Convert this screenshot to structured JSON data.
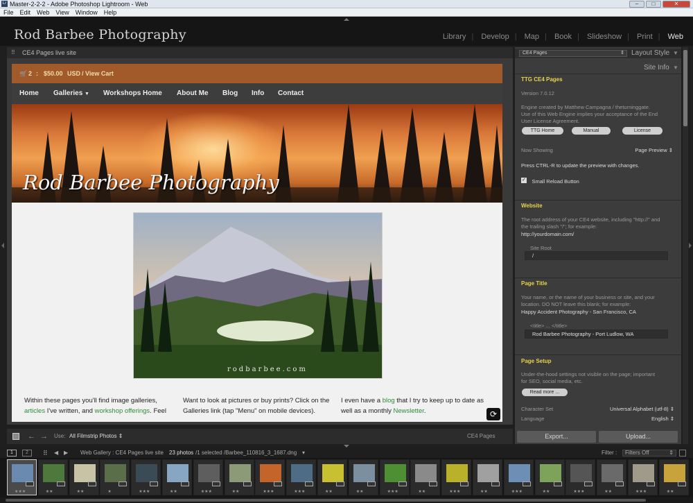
{
  "window": {
    "title": "Master-2-2-2 - Adobe Photoshop Lightroom - Web"
  },
  "menu": [
    "File",
    "Edit",
    "Web",
    "View",
    "Window",
    "Help"
  ],
  "identity_plate": "Rod Barbee Photography",
  "modules": [
    "Library",
    "Develop",
    "Map",
    "Book",
    "Slideshow",
    "Print",
    "Web"
  ],
  "active_module": "Web",
  "preview": {
    "header": "CE4 Pages live site",
    "cart": {
      "count": "2",
      "sep": ":",
      "amount": "$50.00",
      "currency": "USD",
      "view_cart": "/ View Cart"
    },
    "nav": [
      "Home",
      "Galleries",
      "Workshops Home",
      "About Me",
      "Blog",
      "Info",
      "Contact"
    ],
    "banner_title": "Rod Barbee Photography",
    "watermark": "rodbarbee.com",
    "col1": {
      "a": "Within these pages you'll find image galleries,",
      "link1": "articles",
      "b": " I've written, and ",
      "link2": "workshop offerings",
      "c": ". Feel"
    },
    "col2": {
      "a": "Want to look at pictures or buy prints? Click on the Galleries link (tap \"Menu\" on mobile devices)."
    },
    "col3": {
      "a": "I even have a ",
      "link1": "blog",
      "b": " that I try to keep up to date as well as a monthly ",
      "link2": "Newsletter",
      "c": "."
    }
  },
  "toolbar": {
    "use_label": "Use:",
    "use_value": "All Filmstrip Photos",
    "engine": "CE4 Pages"
  },
  "right_panel": {
    "layout_select": "CE4 Pages",
    "layout_style": "Layout Style",
    "site_info": "Site Info",
    "ttg": {
      "header": "TTG CE4 Pages",
      "version": "Version 7.0.12",
      "credit": "Engine created by Matthew Campagna / theturninggate. Use of this Web Engine implies your acceptance of the End User License Agreement.",
      "btn_home": "TTG Home",
      "btn_manual": "Manual",
      "btn_license": "License",
      "now_showing_label": "Now Showing",
      "now_showing_value": "Page Preview",
      "ctrl_r": "Press CTRL-R to update the preview with changes.",
      "small_reload": "Small Reload Button"
    },
    "website": {
      "header": "Website",
      "desc": "The root address of your CE4 website, including \"http://\" and the trailing slash \"/\"; for example:",
      "example": "http://yourdomain.com/",
      "site_root_label": "Site Root",
      "site_root_value": "/"
    },
    "page_title": {
      "header": "Page Title",
      "desc": "Your name, or the name of your business or site, and your location. DO NOT leave this blank; for example:",
      "example": "Happy Accident Photography - San Francisco, CA",
      "field_label": "<title> ... </title>",
      "field_value": "Rod Barbee Photography - Port Ludlow, WA"
    },
    "page_setup": {
      "header": "Page Setup",
      "desc": "Under-the-hood settings not visible on the page; important for SEO, social media, etc.",
      "read_more": "Read more ...",
      "charset_label": "Character Set",
      "charset_value": "Universal Alphabet (utf-8)",
      "language_label": "Language",
      "language_value": "English"
    },
    "export": "Export...",
    "upload": "Upload..."
  },
  "filmstrip": {
    "page1": "1",
    "page2": "2",
    "source": "Web Gallery : CE4 Pages live site",
    "count": "23 photos",
    "selected": "/1 selected /Barbee_110816_3_1687.dng",
    "filter_label": "Filter :",
    "filter_value": "Filters Off",
    "thumbs": [
      {
        "color": "#6a8ab0",
        "stars": "★★★"
      },
      {
        "color": "#4d7a3c",
        "stars": "★★"
      },
      {
        "color": "#c9c3a6",
        "stars": "★★"
      },
      {
        "color": "#5b6e4a",
        "stars": "★"
      },
      {
        "color": "#3a4b55",
        "stars": "★★★"
      },
      {
        "color": "#87a6c2",
        "stars": "★★"
      },
      {
        "color": "#5e5e5e",
        "stars": "★★★"
      },
      {
        "color": "#8c9a78",
        "stars": "★★"
      },
      {
        "color": "#c3642a",
        "stars": "★★★"
      },
      {
        "color": "#4e6c86",
        "stars": "★★★"
      },
      {
        "color": "#c8c030",
        "stars": "★★"
      },
      {
        "color": "#7b8f9e",
        "stars": "★★"
      },
      {
        "color": "#4f8f34",
        "stars": "★★★"
      },
      {
        "color": "#8a8a8a",
        "stars": "★★"
      },
      {
        "color": "#b9b129",
        "stars": "★★★"
      },
      {
        "color": "#a0a0a0",
        "stars": "★★"
      },
      {
        "color": "#6d8fb5",
        "stars": "★★★"
      },
      {
        "color": "#7da25a",
        "stars": "★★"
      },
      {
        "color": "#555555",
        "stars": "★★★"
      },
      {
        "color": "#6a6a6a",
        "stars": "★★"
      },
      {
        "color": "#9f9a8a",
        "stars": "★★★"
      },
      {
        "color": "#c8a23a",
        "stars": "★★"
      }
    ]
  },
  "colors": {
    "accent": "#e9d34a",
    "cart": "#a35a2b",
    "link": "#2f8a3a"
  }
}
